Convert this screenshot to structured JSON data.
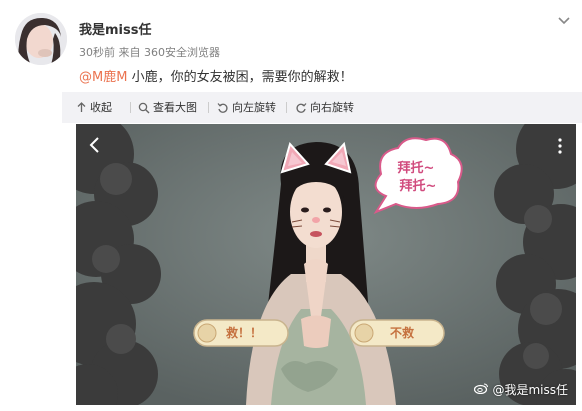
{
  "post": {
    "username": "我是miss任",
    "meta": "30秒前 来自 360安全浏览器",
    "mention": "@M鹿M",
    "text": " 小鹿，你的女友被困，需要你的解救！"
  },
  "toolbar": {
    "collapse_label": "收起",
    "view_large_label": "查看大图",
    "rotate_left_label": "向左旋转",
    "rotate_right_label": "向右旋转"
  },
  "image": {
    "bubble_text_line1": "拜托~",
    "bubble_text_line2": "拜托~",
    "choice_left": "救！！",
    "choice_right": "不救",
    "watermark": "@我是miss任"
  },
  "icons": {
    "expand": "chevron-down-icon",
    "collapse": "arrow-up-icon",
    "view_large": "magnifier-icon",
    "rotate_left": "rotate-left-icon",
    "rotate_right": "rotate-right-icon",
    "back": "chevron-left-icon",
    "more": "more-vertical-icon",
    "watermark_logo": "weibo-logo-icon"
  },
  "colors": {
    "mention": "#eb7350",
    "toolbar_bg": "#f2f2f5",
    "text": "#333333",
    "meta": "#808080"
  }
}
